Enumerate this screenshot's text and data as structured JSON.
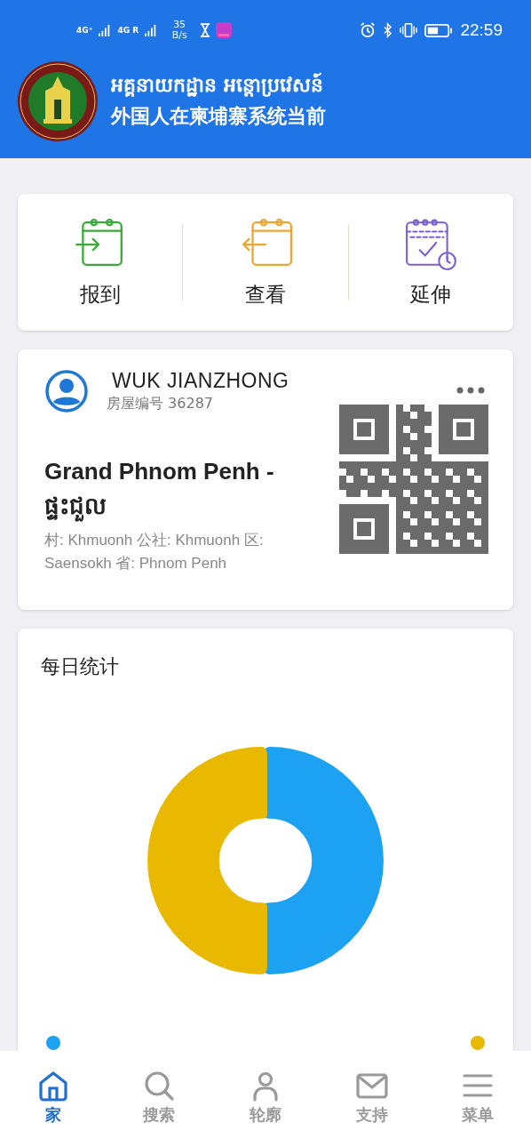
{
  "status_bar": {
    "signal_1": "4G⁺",
    "signal_2": "4G R",
    "speed": "35 B/s",
    "time": "22:59"
  },
  "header": {
    "title_khmer": "អគ្គនាយកដ្ឋាន អន្តោប្រវេសន៍",
    "subtitle": "外国人在柬埔寨系统当前"
  },
  "actions": [
    {
      "label": "报到",
      "kind": "check_in"
    },
    {
      "label": "查看",
      "kind": "view"
    },
    {
      "label": "延伸",
      "kind": "extend"
    }
  ],
  "profile": {
    "name": "WUK JIANZHONG",
    "house_number": "房屋编号 36287",
    "place": "Grand Phnom Penh - ផ្ទះជួល",
    "address": "村: Khmuonh 公社: Khmuonh 区: Saensokh 省: Phnom Penh"
  },
  "stats": {
    "title": "每日统计",
    "legend": [
      {
        "color": "#1da1f2"
      },
      {
        "color": "#e9b800"
      }
    ]
  },
  "nav": [
    {
      "label": "家",
      "kind": "home",
      "selected": true
    },
    {
      "label": "搜索",
      "kind": "search",
      "selected": false
    },
    {
      "label": "轮廓",
      "kind": "profile",
      "selected": false
    },
    {
      "label": "支持",
      "kind": "mail",
      "selected": false
    },
    {
      "label": "菜单",
      "kind": "menu",
      "selected": false
    }
  ]
}
